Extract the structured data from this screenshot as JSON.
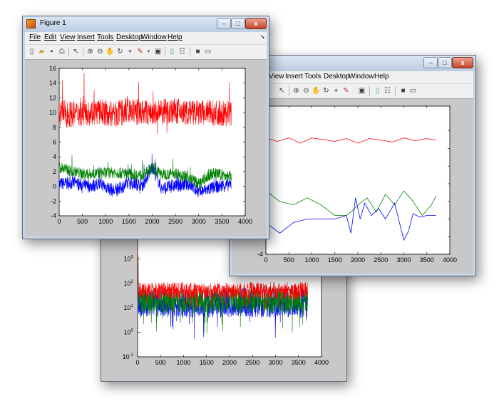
{
  "fig_top": {
    "title": "Figure 1",
    "menu": [
      "File",
      "Edit",
      "View",
      "Insert",
      "Tools",
      "Desktop",
      "Window",
      "Help"
    ],
    "caption": {
      "minimize": "–",
      "maximize": "□",
      "close": "x"
    }
  },
  "fig_right": {
    "menu": [
      "View",
      "Insert",
      "Tools",
      "Desktop",
      "Window",
      "Help"
    ],
    "caption": {
      "minimize": "–",
      "maximize": "□",
      "close": "x"
    }
  },
  "icons": {
    "top_toolbar": [
      "new-file-icon",
      "open-file-icon",
      "save-icon",
      "print-icon",
      "pointer-icon",
      "zoom-in-icon",
      "zoom-out-icon",
      "pan-icon",
      "rotate-icon",
      "data-cursor-icon",
      "brush-icon",
      "link-icon",
      "colorbar-icon",
      "legend-icon",
      "hide-plot-tools-icon",
      "show-plot-tools-icon"
    ],
    "right_toolbar": [
      "pointer-icon",
      "zoom-in-icon",
      "zoom-out-icon",
      "pan-icon",
      "rotate-icon",
      "data-cursor-icon",
      "brush-icon",
      "link-icon",
      "colorbar-icon",
      "legend-icon",
      "hide-plot-tools-icon",
      "show-plot-tools-icon"
    ]
  },
  "colors": {
    "red": "#ff0000",
    "green": "#008000",
    "blue": "#0000ff"
  },
  "chart_data": [
    {
      "id": "top",
      "type": "line",
      "xlim": [
        0,
        4000
      ],
      "ylim": [
        -4,
        16
      ],
      "xticks": [
        0,
        500,
        1000,
        1500,
        2000,
        2500,
        3000,
        3500,
        4000
      ],
      "yticks": [
        -4,
        -2,
        0,
        2,
        4,
        6,
        8,
        10,
        12,
        14,
        16
      ],
      "series": [
        {
          "color": "red",
          "x": [
            0,
            300,
            600,
            900,
            1200,
            1500,
            1800,
            2100,
            2400,
            2700,
            3000,
            3300,
            3700
          ],
          "mean": [
            10,
            9.8,
            10,
            10.1,
            9.7,
            10.2,
            10,
            9.8,
            10.3,
            10,
            9.9,
            10,
            9.8
          ],
          "amp": 1.8
        },
        {
          "color": "green",
          "x": [
            0,
            300,
            600,
            900,
            1200,
            1500,
            1800,
            2000,
            2200,
            2500,
            2800,
            3000,
            3300,
            3700
          ],
          "mean": [
            2.6,
            2,
            1.6,
            1.8,
            1.9,
            1.7,
            1.5,
            2.5,
            1.6,
            1.8,
            1.2,
            0.3,
            1.8,
            1.3
          ],
          "amp": 0.8
        },
        {
          "color": "blue",
          "x": [
            0,
            300,
            600,
            900,
            1200,
            1500,
            1800,
            2000,
            2200,
            2500,
            2800,
            3000,
            3300,
            3700
          ],
          "mean": [
            0.3,
            0.5,
            0,
            0.3,
            -0.7,
            0.5,
            0.2,
            2.7,
            -0.3,
            0.1,
            0.3,
            -0.8,
            -0.2,
            0.3
          ],
          "amp": 0.9
        }
      ]
    },
    {
      "id": "right",
      "type": "line",
      "xlim": [
        0,
        4000
      ],
      "ylim": [
        -4,
        0.2
      ],
      "xticks": [
        0,
        500,
        1000,
        1500,
        2000,
        2500,
        3000,
        3500,
        4000
      ],
      "yticks": [
        -4
      ],
      "series": [
        {
          "color": "red",
          "x": [
            0,
            250,
            500,
            750,
            1000,
            1250,
            1500,
            1750,
            2000,
            2250,
            2500,
            2750,
            3000,
            3250,
            3500,
            3700
          ],
          "y": [
            -0.7,
            -0.8,
            -0.7,
            -0.85,
            -0.7,
            -0.75,
            -0.8,
            -0.72,
            -0.85,
            -0.72,
            -0.76,
            -0.82,
            -0.7,
            -0.78,
            -0.72,
            -0.76
          ]
        },
        {
          "color": "green",
          "x": [
            0,
            300,
            600,
            900,
            1200,
            1500,
            1750,
            1900,
            2000,
            2200,
            2400,
            2600,
            2800,
            3000,
            3200,
            3400,
            3600,
            3700
          ],
          "y": [
            -2.2,
            -2.5,
            -2.6,
            -2.4,
            -2.6,
            -2.9,
            -2.9,
            -2.75,
            -2.6,
            -2.4,
            -2.8,
            -2.3,
            -2.6,
            -2.2,
            -2.5,
            -2.9,
            -2.6,
            -2.35
          ]
        },
        {
          "color": "blue",
          "x": [
            0,
            300,
            600,
            900,
            1200,
            1500,
            1750,
            1850,
            1950,
            2050,
            2150,
            2300,
            2450,
            2600,
            2800,
            3000,
            3100,
            3200,
            3350,
            3500,
            3700
          ],
          "y": [
            -3.1,
            -3.4,
            -3.1,
            -3.0,
            -3.0,
            -3.0,
            -2.9,
            -3.4,
            -2.4,
            -3.0,
            -2.55,
            -2.9,
            -2.7,
            -3.0,
            -2.55,
            -3.6,
            -3.35,
            -2.85,
            -2.95,
            -2.9,
            -2.9
          ]
        }
      ]
    },
    {
      "id": "bottom",
      "type": "line",
      "scale_y": "log",
      "xlim": [
        0,
        4000
      ],
      "ylim_exp": [
        -1,
        4
      ],
      "xticks": [
        0,
        500,
        1000,
        1500,
        2000,
        2500,
        3000,
        3500,
        4000
      ],
      "yticks_exp": [
        -1,
        0,
        1,
        2,
        3
      ],
      "series": [
        {
          "color": "blue",
          "logmean": 1.2,
          "amp": 0.6
        },
        {
          "color": "green",
          "logmean": 1.3,
          "amp": 0.55
        },
        {
          "color": "red",
          "logmean": 1.7,
          "amp": 0.35
        }
      ]
    }
  ]
}
